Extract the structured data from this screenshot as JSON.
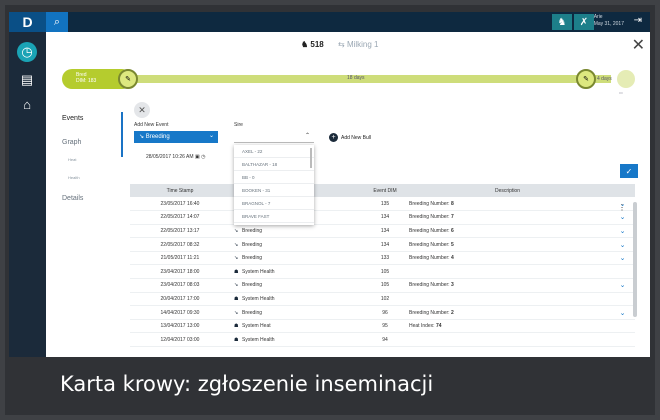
{
  "app": {
    "logo": "D",
    "caption": "Karta krowy: zgłoszenie inseminacji"
  },
  "topbar": {
    "user_line1": "Arie",
    "user_line2": "May 31, 2017"
  },
  "header": {
    "cow_number": "518",
    "cow_status": "Milking 1"
  },
  "timeline": {
    "start_label": "Bred",
    "start_sub": "DIM: 183",
    "mid_label": "18 days",
    "end_label": "4 days"
  },
  "nav": {
    "events": "Events",
    "graph": "Graph",
    "graph_sub1": "Heat",
    "graph_sub2": "Health",
    "details": "Details"
  },
  "form": {
    "add_event_label": "Add New Event",
    "event_type": "Breeding",
    "sire_label": "Sire",
    "datetime": "28/05/2017 10:26 AM",
    "add_bull": "Add New Bull",
    "sire_options": [
      "AXEL - 22",
      "BALTHAZAR - 18",
      "BB - 0",
      "BOOKEN - 31",
      "BRAGNOL - 7",
      "BRAVE FAST"
    ]
  },
  "table": {
    "headers": [
      "Time Stamp",
      "",
      "Event DIM",
      "Description",
      ""
    ],
    "rows": [
      {
        "time": "23/05/2017 16:40",
        "event": "",
        "dim": "135",
        "desc": "Breeding Number:",
        "desc_val": "8",
        "chev": "⌄"
      },
      {
        "time": "22/05/2017 14:07",
        "event": "",
        "dim": "134",
        "desc": "Breeding Number:",
        "desc_val": "7",
        "chev": "⌄"
      },
      {
        "time": "22/05/2017 13:17",
        "event": "Breeding",
        "dim": "134",
        "desc": "Breeding Number:",
        "desc_val": "6",
        "chev": "⌄"
      },
      {
        "time": "22/05/2017 08:32",
        "event": "Breeding",
        "dim": "134",
        "desc": "Breeding Number:",
        "desc_val": "5",
        "chev": "⌄"
      },
      {
        "time": "21/05/2017 11:21",
        "event": "Breeding",
        "dim": "133",
        "desc": "Breeding Number:",
        "desc_val": "4",
        "chev": "⌄"
      },
      {
        "time": "23/04/2017 18:00",
        "event": "System Health",
        "dim": "105",
        "desc": "",
        "desc_val": "",
        "chev": ""
      },
      {
        "time": "23/04/2017 08:03",
        "event": "Breeding",
        "dim": "105",
        "desc": "Breeding Number:",
        "desc_val": "3",
        "chev": "⌄"
      },
      {
        "time": "20/04/2017 17:00",
        "event": "System Health",
        "dim": "102",
        "desc": "",
        "desc_val": "",
        "chev": ""
      },
      {
        "time": "14/04/2017 09:30",
        "event": "Breeding",
        "dim": "96",
        "desc": "Breeding Number:",
        "desc_val": "2",
        "chev": "⌄"
      },
      {
        "time": "13/04/2017 13:00",
        "event": "System Heat",
        "dim": "95",
        "desc": "Heat Index:",
        "desc_val": "74",
        "chev": ""
      },
      {
        "time": "12/04/2017 03:00",
        "event": "System Health",
        "dim": "94",
        "desc": "",
        "desc_val": "",
        "chev": ""
      }
    ]
  }
}
